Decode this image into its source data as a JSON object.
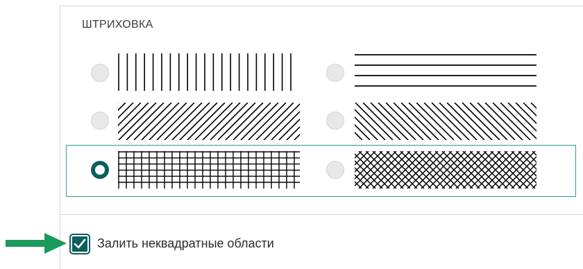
{
  "hatching": {
    "title": "ШТРИХОВКА",
    "options": [
      {
        "pattern": "vertical-lines-icon",
        "selected": false
      },
      {
        "pattern": "horizontal-lines-icon",
        "selected": false
      },
      {
        "pattern": "diagonal-lines-forward-icon",
        "selected": false
      },
      {
        "pattern": "diagonal-lines-backward-icon",
        "selected": false
      },
      {
        "pattern": "grid-icon",
        "selected": true
      },
      {
        "pattern": "crosshatch-icon",
        "selected": false
      }
    ]
  },
  "fill_option": {
    "label": "Залить неквадратные области",
    "checked": true
  },
  "colors": {
    "accent": "#0e5e5b",
    "selection_border": "#2a9d8f",
    "arrow": "#1a9a5c"
  }
}
